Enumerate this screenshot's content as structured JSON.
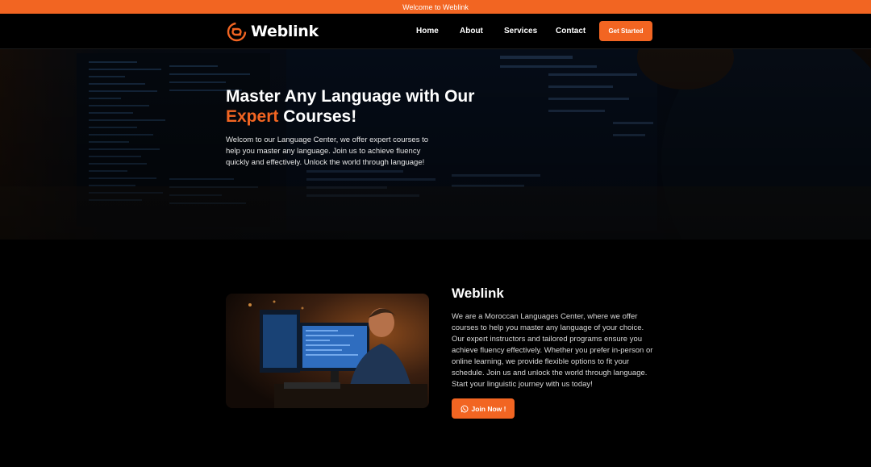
{
  "topbar": {
    "text": "Welcome to Weblink"
  },
  "brand": {
    "name": "Weblink",
    "accent": "#f26522"
  },
  "nav": {
    "items": [
      "Home",
      "About",
      "Services",
      "Contact"
    ],
    "cta": "Get Started"
  },
  "hero": {
    "title_line1": "Master Any Language with Our",
    "title_accent": "Expert",
    "title_rest": "Courses!",
    "text": "Welcom to our Language Center, we offer expert courses to help you master any language. Join us to achieve fluency quickly and effectively. Unlock the world through language!"
  },
  "about": {
    "title": "Weblink",
    "text": "We are a Moroccan Languages Center, where we offer courses to help you master any language of your choice. Our expert instructors and tailored programs ensure you achieve fluency effectively. Whether you prefer in-person or online learning, we provide flexible options to fit your schedule. Join us and unlock the world through language. Start your linguistic journey with us today!",
    "button": "Join Now !"
  },
  "icons": {
    "logo": "weblink-logo-icon",
    "button": "whatsapp-icon"
  }
}
